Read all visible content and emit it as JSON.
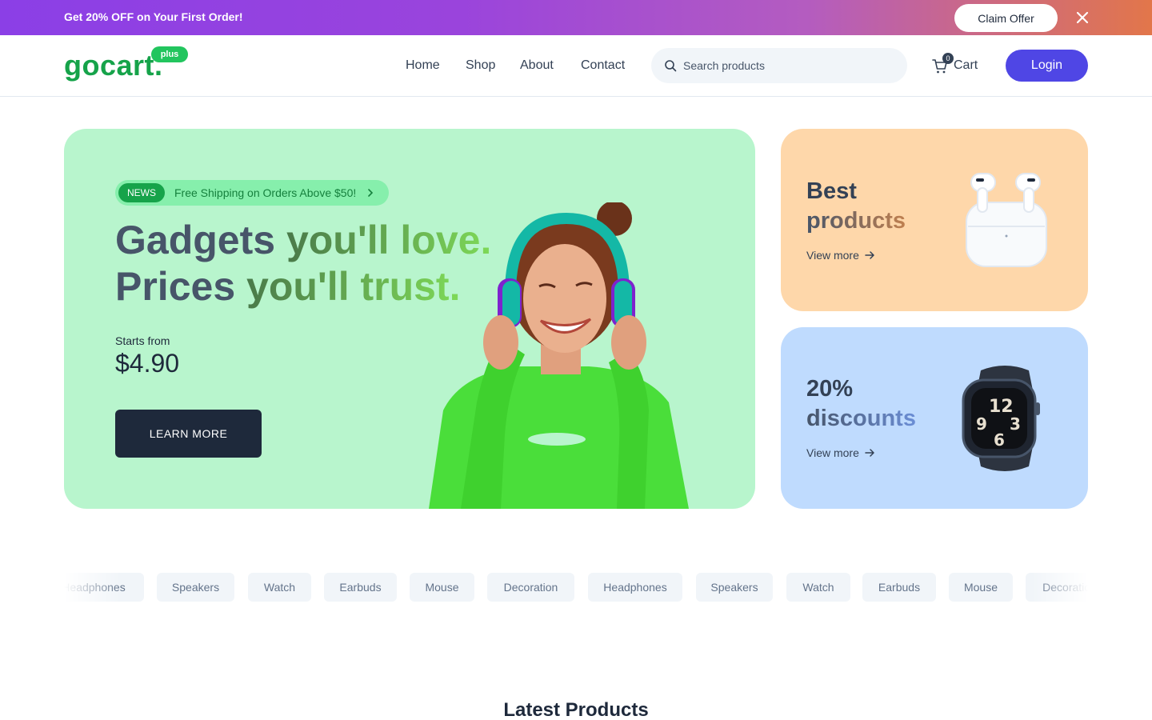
{
  "promo": {
    "text": "Get 20% OFF on Your First Order!",
    "claim_label": "Claim Offer",
    "gradient": [
      "#8b3fe6",
      "#e2764a"
    ]
  },
  "header": {
    "logo": {
      "main": "gocart",
      "dot": ".",
      "badge": "plus"
    },
    "nav": [
      "Home",
      "Shop",
      "About",
      "Contact"
    ],
    "search_placeholder": "Search products",
    "cart_count": "0",
    "cart_label": "Cart",
    "login_label": "Login",
    "accent": "#4f46e5"
  },
  "hero": {
    "news_tag": "NEWS",
    "news_text": "Free Shipping on Orders Above $50!",
    "headline_line1_a": "Gadgets ",
    "headline_line1_b": "you'll love.",
    "headline_line2_a": "Prices ",
    "headline_line2_b": "you'll trust.",
    "starts_from": "Starts from",
    "price": "$4.90",
    "cta": "LEARN MORE",
    "background": "#b8f5cd"
  },
  "cards": [
    {
      "title_a": "Best",
      "title_b": "products",
      "link": "View more",
      "image": "earbuds-case",
      "background": "#fed7aa"
    },
    {
      "title_a": "20%",
      "title_b": "discounts",
      "link": "View more",
      "image": "smartwatch",
      "background": "#bfdbfe"
    }
  ],
  "categories": [
    "Headphones",
    "Speakers",
    "Watch",
    "Earbuds",
    "Mouse",
    "Decoration",
    "Headphones",
    "Speakers",
    "Watch",
    "Earbuds",
    "Mouse",
    "Decoration"
  ],
  "latest_title": "Latest Products"
}
